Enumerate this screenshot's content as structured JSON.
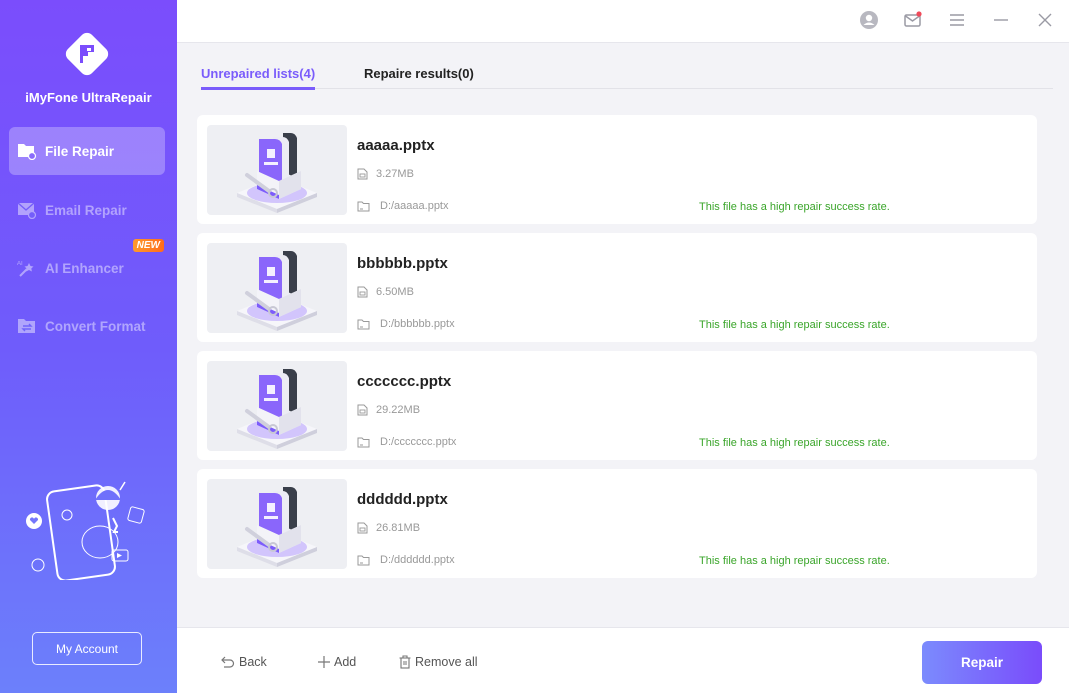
{
  "app": {
    "name": "iMyFone UltraRepair"
  },
  "sidebar": {
    "items": [
      {
        "label": "File Repair",
        "icon": "file-repair-icon",
        "active": true
      },
      {
        "label": "Email Repair",
        "icon": "email-repair-icon",
        "active": false
      },
      {
        "label": "AI Enhancer",
        "icon": "ai-enhancer-icon",
        "active": false,
        "badge": "NEW"
      },
      {
        "label": "Convert Format",
        "icon": "convert-format-icon",
        "active": false
      }
    ],
    "account_label": "My Account"
  },
  "topbar": {
    "icons": [
      "account-icon",
      "mail-icon",
      "menu-icon",
      "minimize-icon",
      "close-icon"
    ],
    "mail_has_notification": true
  },
  "tabs": [
    {
      "label": "Unrepaired lists(4)",
      "active": true
    },
    {
      "label": "Repaire results(0)",
      "active": false
    }
  ],
  "files": [
    {
      "name": "aaaaa.pptx",
      "size": "3.27MB",
      "path": "D:/aaaaa.pptx",
      "status": "This file has a high repair success rate."
    },
    {
      "name": "bbbbbb.pptx",
      "size": "6.50MB",
      "path": "D:/bbbbbb.pptx",
      "status": "This file has a high repair success rate."
    },
    {
      "name": "ccccccc.pptx",
      "size": "29.22MB",
      "path": "D:/ccccccc.pptx",
      "status": "This file has a high repair success rate."
    },
    {
      "name": "dddddd.pptx",
      "size": "26.81MB",
      "path": "D:/dddddd.pptx",
      "status": "This file has a high repair success rate."
    }
  ],
  "footer": {
    "back_label": "Back",
    "add_label": "Add",
    "remove_all_label": "Remove all",
    "repair_label": "Repair"
  },
  "colors": {
    "accent": "#7a5cfb",
    "success": "#3aa52a",
    "badge": "#ff7a22"
  }
}
